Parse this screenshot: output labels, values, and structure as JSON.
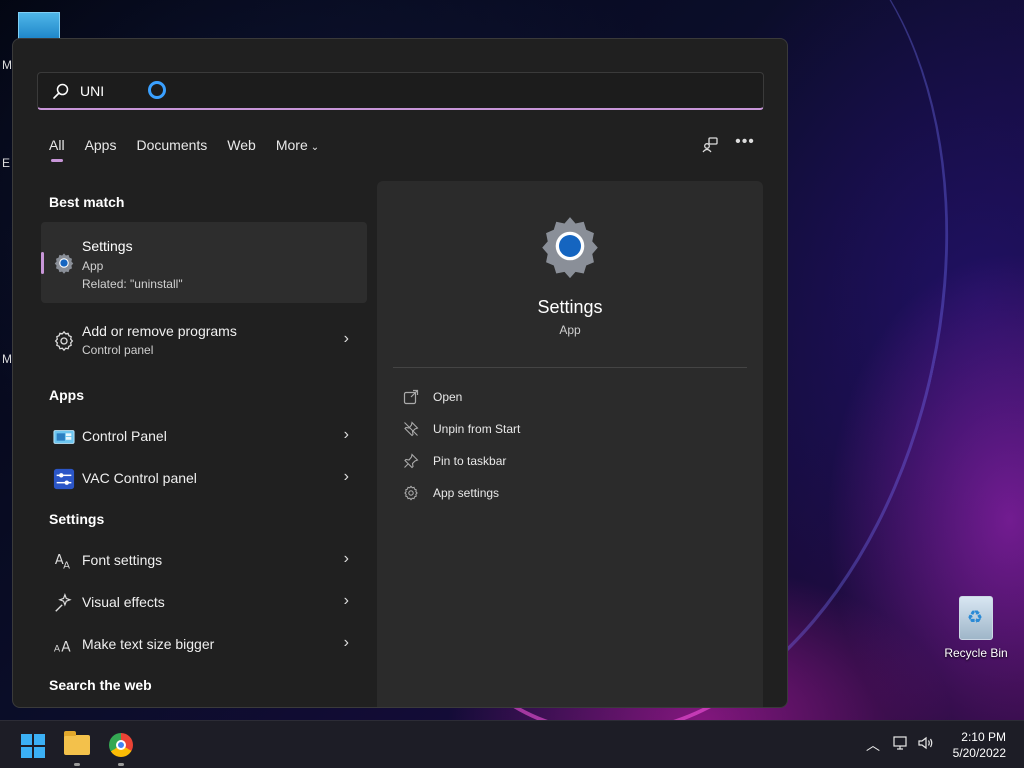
{
  "search": {
    "query": "UNI"
  },
  "tabs": [
    {
      "label": "All"
    },
    {
      "label": "Apps"
    },
    {
      "label": "Documents"
    },
    {
      "label": "Web"
    },
    {
      "label": "More"
    }
  ],
  "best_match": {
    "heading": "Best match",
    "title": "Settings",
    "type": "App",
    "related": "Related: \"uninstall\""
  },
  "control_panel_item": {
    "title": "Add or remove programs",
    "subtitle": "Control panel"
  },
  "apps_section": {
    "heading": "Apps",
    "items": [
      {
        "label": "Control Panel"
      },
      {
        "label": "VAC Control panel"
      }
    ]
  },
  "settings_section": {
    "heading": "Settings",
    "items": [
      {
        "label": "Font settings"
      },
      {
        "label": "Visual effects"
      },
      {
        "label": "Make text size bigger"
      }
    ]
  },
  "web_section": {
    "heading": "Search the web"
  },
  "detail": {
    "title": "Settings",
    "subtitle": "App",
    "actions": [
      {
        "label": "Open",
        "icon": "open-icon"
      },
      {
        "label": "Unpin from Start",
        "icon": "unpin-icon"
      },
      {
        "label": "Pin to taskbar",
        "icon": "pin-icon"
      },
      {
        "label": "App settings",
        "icon": "gear-icon"
      }
    ]
  },
  "desktop": {
    "recycle_bin_label": "Recycle Bin",
    "edge_letters": [
      "M",
      "E",
      "M"
    ]
  },
  "taskbar": {
    "time": "2:10 PM",
    "date": "5/20/2022"
  },
  "colors": {
    "accent": "#c896d8",
    "panel": "#202020",
    "detail_pane": "#2b2b2b",
    "taskbar": "#1d1d26"
  }
}
